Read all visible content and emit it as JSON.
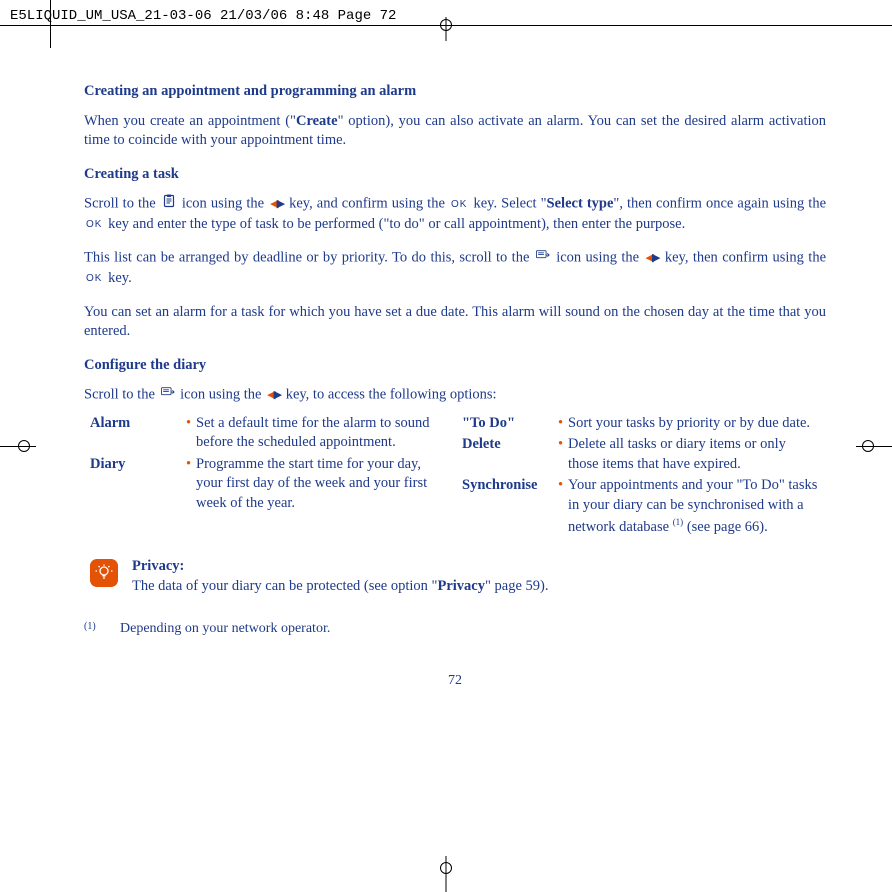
{
  "header": "E5LIQUID_UM_USA_21-03-06  21/03/06  8:48  Page 72",
  "sections": {
    "h1": "Creating an appointment and programming an alarm",
    "p1a": "When you create an appointment (\"",
    "p1b": "Create",
    "p1c": "\" option), you can also activate an alarm. You can set the desired alarm activation time to coincide with your appointment time.",
    "h2": "Creating a task",
    "p2a": "Scroll to the ",
    "p2b": " icon using the ",
    "p2c": " key, and confirm using the ",
    "p2d": " key. Select \"",
    "p2e": "Select type",
    "p2f": "\", then confirm once again using the ",
    "p2g": " key and enter the type of task to be performed (\"to do\" or call appointment), then enter the purpose.",
    "p3a": "This list can be arranged by deadline or by priority. To do this, scroll to the ",
    "p3b": " icon using the ",
    "p3c": " key, then confirm using the ",
    "p3d": " key.",
    "p4": "You can set an alarm for a task for which you have set a due date. This alarm will sound on the chosen day at the time that you entered.",
    "h3": "Configure the diary",
    "p5a": "Scroll to the ",
    "p5b": " icon using the ",
    "p5c": " key, to access the following options:"
  },
  "options": {
    "left": [
      {
        "label": "Alarm",
        "desc": "Set a default time for the alarm to sound before the scheduled appointment."
      },
      {
        "label": "Diary",
        "desc": "Programme the start time for your day, your first day of the week and your first week of the year."
      }
    ],
    "right": [
      {
        "label": "\"To Do\"",
        "desc": "Sort your tasks by priority or by due date."
      },
      {
        "label": "Delete",
        "desc": "Delete all tasks or diary items or only those items that have expired."
      },
      {
        "label": "Synchronise",
        "desc_a": "Your appointments and your \"To Do\" tasks in your diary can be synchronised with a network database ",
        "desc_sup": "(1)",
        "desc_b": " (see page 66)."
      }
    ]
  },
  "tip": {
    "title": "Privacy",
    "text_a": "The data of your diary can be protected (see option \"",
    "text_b": "Privacy",
    "text_c": "\" page 59)."
  },
  "footnote": {
    "mark": "(1)",
    "text": "Depending on your network operator."
  },
  "page_number": "72",
  "ok_label": "OK"
}
